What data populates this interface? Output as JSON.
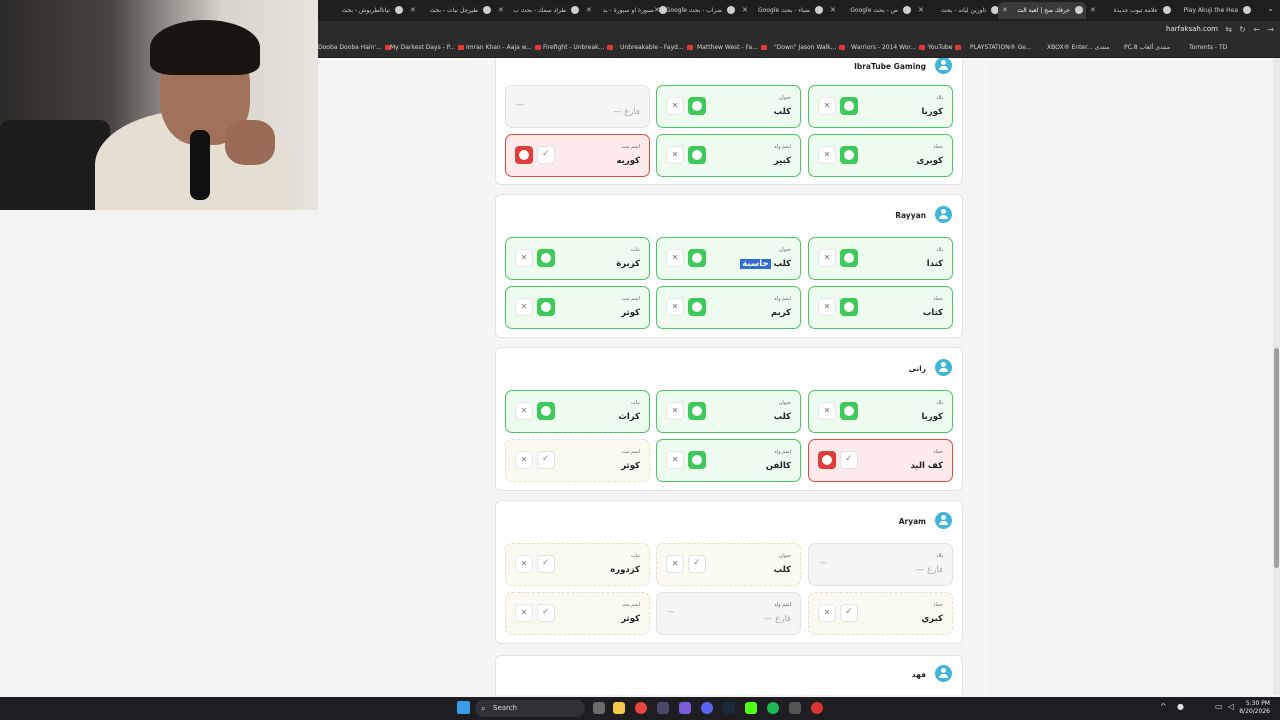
{
  "tabs": [
    {
      "label": "تيانالطريوش - بحث"
    },
    {
      "label": "طيرجل نبات - بحث"
    },
    {
      "label": "طراد سمك - بحث ب"
    },
    {
      "label": "صبورة او سبورة - بد"
    },
    {
      "label": "ضراب - بحث Google"
    },
    {
      "label": "ضباء - بحث Google"
    },
    {
      "label": "ض - بحث Google"
    },
    {
      "label": "تاوزين لياند - بحث"
    },
    {
      "label": "حرفك صح | لعبة الث"
    },
    {
      "label": "علامة تيوب جديدة"
    },
    {
      "label": "Play Akuji the Hea"
    }
  ],
  "address": {
    "url": "harfaksah.com"
  },
  "bookmarks": [
    "Dooba Dooba Hain'...",
    "My Darkest Days - P...",
    "Imran Khan - Aaja w...",
    "Firefight - Unbreak...",
    "Unbreakable - Fayd...",
    "Matthew West - Fa...",
    "\"Down\" Jason Walk...",
    "Warriors - 2014 Wor...",
    "YouTube",
    "PLAYSTATION® Ge...",
    "XBOX® Enter... منتدى",
    "PC.8 منتدى ألعاب",
    "Torrents - TD"
  ],
  "cards": [
    {
      "player": "IbraTube Gaming",
      "cells": [
        {
          "category": "بلاد",
          "answer": "كوريا",
          "status": "ok"
        },
        {
          "category": "حيوان",
          "answer": "كلب",
          "status": "ok"
        },
        {
          "category": "",
          "answer": "— فارغ",
          "status": "empty"
        },
        {
          "category": "جماد",
          "answer": "كوبرى",
          "status": "ok"
        },
        {
          "category": "اسم ولد",
          "answer": "كبير",
          "status": "ok"
        },
        {
          "category": "اسم بنت",
          "answer": "كوريه",
          "status": "bad"
        }
      ]
    },
    {
      "player": "Rayyan",
      "cells": [
        {
          "category": "بلاد",
          "answer": "كندا",
          "status": "ok"
        },
        {
          "category": "حيوان",
          "answer": "كلب",
          "highlight": "حاسبة",
          "status": "ok"
        },
        {
          "category": "نبات",
          "answer": "كزبرة",
          "status": "ok"
        },
        {
          "category": "جماد",
          "answer": "كتاب",
          "status": "ok"
        },
        {
          "category": "اسم ولد",
          "answer": "كريم",
          "status": "ok"
        },
        {
          "category": "اسم بنت",
          "answer": "كوثر",
          "status": "ok"
        }
      ]
    },
    {
      "player": "رانى",
      "cells": [
        {
          "category": "بلاد",
          "answer": "كوريا",
          "status": "ok"
        },
        {
          "category": "حيوان",
          "answer": "كلب",
          "status": "ok"
        },
        {
          "category": "نبات",
          "answer": "كراث",
          "status": "ok"
        },
        {
          "category": "جماد",
          "answer": "كف اليد",
          "status": "bad"
        },
        {
          "category": "اسم ولد",
          "answer": "كالفن",
          "status": "ok"
        },
        {
          "category": "اسم بنت",
          "answer": "كوثر",
          "status": "pend"
        }
      ]
    },
    {
      "player": "Aryam",
      "cells": [
        {
          "category": "بلاد",
          "answer": "— فارغ",
          "status": "empty"
        },
        {
          "category": "حيوان",
          "answer": "كلب",
          "status": "pend"
        },
        {
          "category": "نبات",
          "answer": "كزدوره",
          "status": "pend"
        },
        {
          "category": "جماد",
          "answer": "كبري",
          "status": "pend"
        },
        {
          "category": "اسم ولد",
          "answer": "— فارغ",
          "status": "empty"
        },
        {
          "category": "اسم بنت",
          "answer": "كوثر",
          "status": "pend"
        }
      ]
    },
    {
      "player": "فهد",
      "cells": []
    }
  ],
  "taskbar": {
    "search_placeholder": "Search",
    "time": "5:30 PM",
    "date": "8/20/2026"
  },
  "colors": {
    "ok": "#48c763",
    "bad": "#e04848",
    "accent": "#3fb5d9"
  }
}
